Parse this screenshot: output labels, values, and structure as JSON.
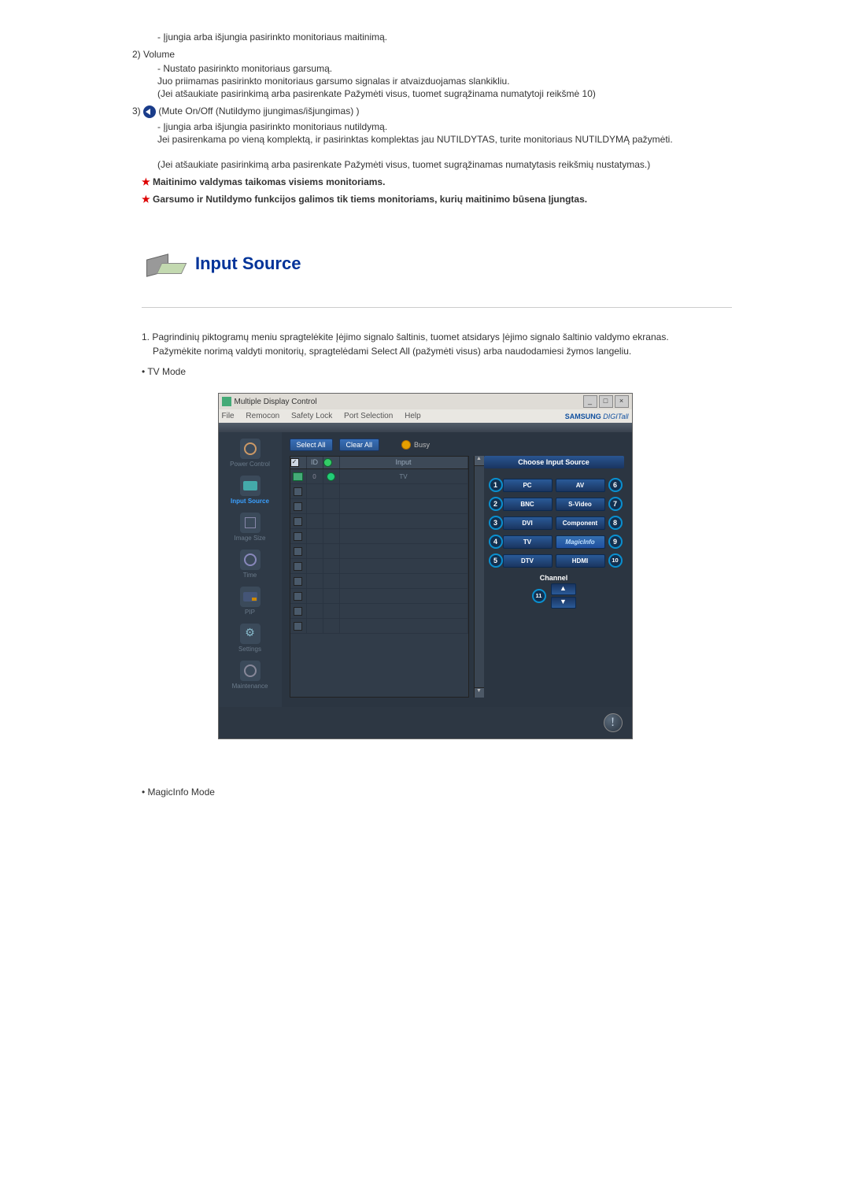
{
  "intro": {
    "dash1": "- Įjungia arba išjungia pasirinkto monitoriaus maitinimą.",
    "item2": "2)  Volume",
    "dash2": "- Nustato pasirinkto monitoriaus garsumą.",
    "line2a": "Juo priimamas pasirinkto monitoriaus garsumo signalas ir atvaizduojamas slankikliu.",
    "line2b": "(Jei atšaukiate pasirinkimą arba pasirenkate Pažymėti visus, tuomet sugrąžinama numatytoji reikšmė 10)",
    "item3pre": "3)",
    "item3post": "(Mute On/Off (Nutildymo įjungimas/išjungimas) )",
    "dash3": "- Įjungia arba išjungia pasirinkto monitoriaus nutildymą.",
    "line3a": "Jei pasirenkama po vieną komplektą, ir pasirinktas komplektas jau NUTILDYTAS, turite monitoriaus NUTILDYMĄ pažymėti.",
    "line3b": "(Jei atšaukiate pasirinkimą arba pasirenkate Pažymėti visus, tuomet sugrąžinamas numatytasis reikšmių nustatymas.)",
    "star1": "Maitinimo valdymas taikomas visiems monitoriams.",
    "star2": "Garsumo ir Nutildymo funkcijos galimos tik tiems monitoriams, kurių maitinimo būsena Įjungtas."
  },
  "section": {
    "title": "Input Source"
  },
  "instr": {
    "n1": "1.  Pagrindinių piktogramų meniu spragtelėkite Įėjimo signalo šaltinis, tuomet atsidarys Įėjimo signalo šaltinio valdymo ekranas.",
    "n1b": "Pažymėkite norimą valdyti monitorių, spragtelėdami Select All (pažymėti visus) arba naudodamiesi žymos langeliu.",
    "b1": "•  TV Mode",
    "b2": "•  MagicInfo Mode"
  },
  "win": {
    "title": "Multiple Display Control",
    "menu": [
      "File",
      "Remocon",
      "Safety Lock",
      "Port Selection",
      "Help"
    ],
    "brand": "SAMSUNG DIGITall",
    "toolbar": {
      "select": "Select All",
      "clear": "Clear All",
      "busy": "Busy"
    },
    "side": {
      "pc": "Power Control",
      "is": "Input Source",
      "sz": "Image Size",
      "tm": "Time",
      "pip": "PIP",
      "st": "Settings",
      "mt": "Maintenance"
    },
    "grid": {
      "h_id": "ID",
      "h_input": "Input",
      "row1_id": "0",
      "row1_input": "TV"
    },
    "panel": {
      "head": "Choose Input Source",
      "sources": {
        "1": "PC",
        "2": "BNC",
        "3": "DVI",
        "4": "TV",
        "5": "DTV",
        "6": "AV",
        "7": "S-Video",
        "8": "Component",
        "9": "MagicInfo",
        "10": "HDMI"
      },
      "channel": "Channel",
      "badge11": "11"
    }
  }
}
